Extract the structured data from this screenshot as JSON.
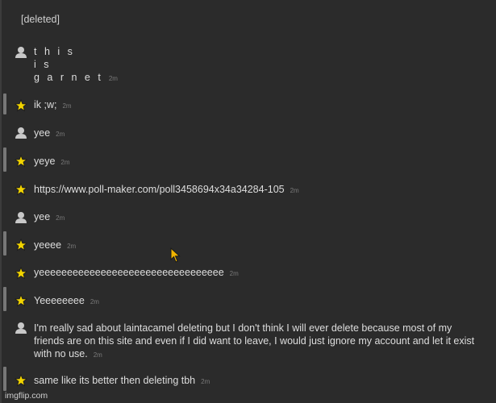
{
  "header": {
    "deleted_label": "[deleted]"
  },
  "messages": [
    {
      "icon": "user-icon",
      "lines": [
        "t h i s",
        "i s",
        "g a r n e t"
      ],
      "time": "2m"
    },
    {
      "icon": "star-icon",
      "text": "ik ;w;",
      "time": "2m"
    },
    {
      "icon": "user-icon",
      "text": "yee",
      "time": "2m"
    },
    {
      "icon": "star-icon",
      "text": "yeye",
      "time": "2m"
    },
    {
      "icon": "star-icon",
      "text": "https://www.poll-maker.com/poll3458694x34a34284-105",
      "time": "2m"
    },
    {
      "icon": "user-icon",
      "text": "yee",
      "time": "2m"
    },
    {
      "icon": "star-icon",
      "text": "yeeee",
      "time": "2m"
    },
    {
      "icon": "star-icon",
      "text": "yeeeeeeeeeeeeeeeeeeeeeeeeeeeeeeeee",
      "time": "2m"
    },
    {
      "icon": "star-icon",
      "text": "Yeeeeeeee",
      "time": "2m"
    },
    {
      "icon": "user-icon",
      "text": "I'm really sad about laintacamel deleting but I don't think I will ever delete because most of my friends are on this site and even if I did want to leave, I would just ignore my account and let it exist with no use.",
      "time": "2m"
    },
    {
      "icon": "star-icon",
      "text": "same like its better then deleting tbh",
      "time": "2m"
    }
  ],
  "colors": {
    "background": "#2b2b2b",
    "star": "#f2d400",
    "user": "#c8c8c8",
    "thread_bar": "#777777"
  },
  "watermark": "imgflip.com"
}
